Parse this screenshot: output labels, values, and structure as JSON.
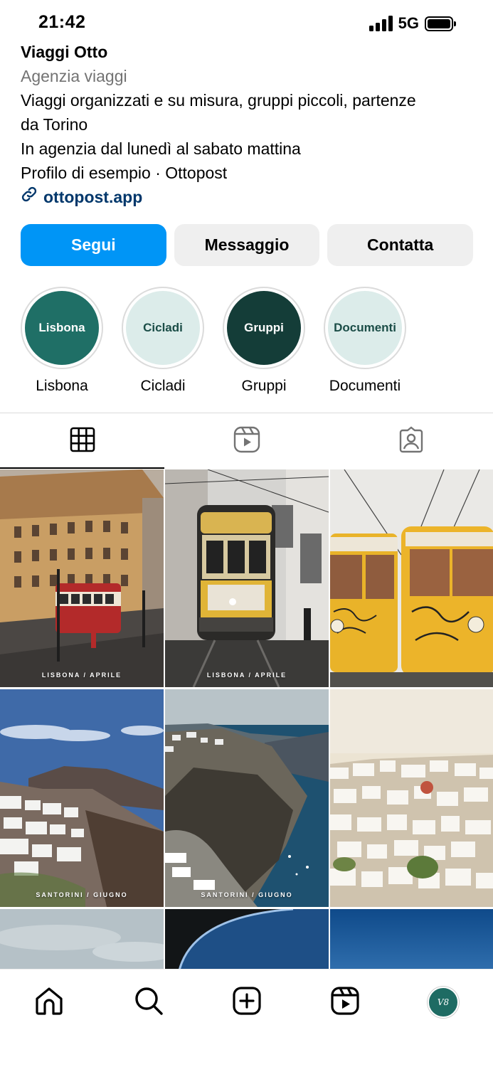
{
  "status_bar": {
    "time": "21:42",
    "network": "5G"
  },
  "profile": {
    "name": "Viaggi Otto",
    "category": "Agenzia viaggi",
    "bio_lines": [
      "Viaggi organizzati e su misura, gruppi piccoli, partenze",
      "da Torino",
      "In agenzia dal lunedì al sabato mattina",
      "Profilo di esempio · Ottopost"
    ],
    "link": "ottopost.app",
    "link_icon": "link-icon"
  },
  "actions": {
    "follow": "Segui",
    "message": "Messaggio",
    "contact": "Contatta"
  },
  "highlights": [
    {
      "circle_text": "Lisbona",
      "label": "Lisbona",
      "bg": "#1f6f66",
      "fg": "#ffffff"
    },
    {
      "circle_text": "Cicladi",
      "label": "Cicladi",
      "bg": "#dcecea",
      "fg": "#1b4d47"
    },
    {
      "circle_text": "Gruppi",
      "label": "Gruppi",
      "bg": "#143d38",
      "fg": "#ffffff"
    },
    {
      "circle_text": "Documenti",
      "label": "Documenti",
      "bg": "#dcecea",
      "fg": "#1b4d47"
    }
  ],
  "tabs": [
    {
      "icon": "grid-icon",
      "active": true
    },
    {
      "icon": "reels-icon",
      "active": false
    },
    {
      "icon": "tagged-icon",
      "active": false
    }
  ],
  "posts": [
    {
      "caption": "LISBONA / APRILE",
      "scene": "lisbon-square-tram"
    },
    {
      "caption": "LISBONA / APRILE",
      "scene": "lisbon-tram-front"
    },
    {
      "caption": "",
      "scene": "lisbon-two-trams"
    },
    {
      "caption": "SANTORINI / GIUGNO",
      "scene": "santorini-village-sea"
    },
    {
      "caption": "SANTORINI / GIUGNO",
      "scene": "santorini-caldera-cliff"
    },
    {
      "caption": "",
      "scene": "cyclades-white-town"
    },
    {
      "caption": "",
      "scene": "sky-clouds"
    },
    {
      "caption": "",
      "scene": "dark-arc"
    },
    {
      "caption": "",
      "scene": "blue-sky"
    }
  ],
  "bottom_nav": [
    {
      "icon": "home-icon"
    },
    {
      "icon": "search-icon"
    },
    {
      "icon": "create-icon"
    },
    {
      "icon": "reels-icon"
    },
    {
      "icon": "profile-avatar",
      "text": "V8"
    }
  ],
  "colors": {
    "accent": "#0095f6",
    "link": "#00376b",
    "secondary_text": "#737373",
    "button_grey": "#efefef"
  }
}
